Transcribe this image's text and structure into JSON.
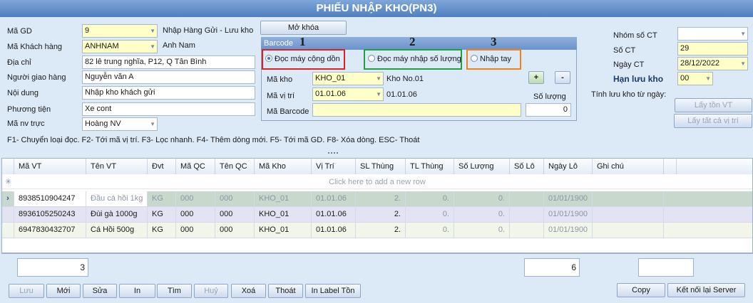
{
  "title": "PHIẾU NHẬP KHO(PN3)",
  "form": {
    "ma_gd": {
      "label": "Mã GD",
      "value": "9",
      "note": "Nhập Hàng Gửi - Lưu kho"
    },
    "ma_kh": {
      "label": "Mã Khách hàng",
      "value": "ANHNAM",
      "note": "Anh Nam"
    },
    "dia_chi": {
      "label": "Địa chỉ",
      "value": "82 lê trung nghĩa, P12, Q Tân Bình"
    },
    "nguoi_giao": {
      "label": "Người giao hàng",
      "value": "Nguyễn văn A"
    },
    "noi_dung": {
      "label": "Nội dung",
      "value": "Nhập kho khách gửi"
    },
    "phuong_tien": {
      "label": "Phương tiện",
      "value": "Xe cont"
    },
    "ma_nv": {
      "label": "Mã nv trực",
      "value": "Hoàng NV"
    }
  },
  "mo_khoa_label": "Mở khóa",
  "barcode": {
    "header": "Barcode",
    "numbers": [
      "1",
      "2",
      "3"
    ],
    "options": [
      "Đọc máy cộng dồn",
      "Đọc máy nhập số lượng",
      "Nhập tay"
    ],
    "ma_kho": {
      "label": "Mã kho",
      "value": "KHO_01",
      "note": "Kho No.01"
    },
    "ma_vi_tri": {
      "label": "Mã vị trí",
      "value": "01.01.06",
      "note": "01.01.06"
    },
    "ma_barcode": {
      "label": "Mã Barcode",
      "value": ""
    },
    "so_luong": {
      "label": "Số lượng",
      "value": "0"
    },
    "plus": "+",
    "minus": "-"
  },
  "right": {
    "nhom_so_ct": {
      "label": "Nhóm số CT",
      "value": ""
    },
    "so_ct": {
      "label": "Số CT",
      "value": "29"
    },
    "ngay_ct": {
      "label": "Ngày CT",
      "value": "28/12/2022"
    },
    "han_luu_kho": {
      "label": "Hạn lưu kho",
      "value": "00"
    },
    "tinh_luu_kho": "Tính lưu kho từ ngày:",
    "lay_ton_vt": "Lấy tồn VT",
    "lay_tat_ca": "Lấy tất cả vị trí"
  },
  "hotkeys": "F1- Chuyển loại đọc. F2- Tới mã vị trí. F3- Lọc nhanh. F4- Thêm dòng mới. F5- Tới mã GD. F8- Xóa dòng. ESC- Thoát",
  "grid": {
    "columns": [
      "Mã VT",
      "Tên VT",
      "Đvt",
      "Mã QC",
      "Tên QC",
      "Mã Kho",
      "Vị Trí",
      "SL Thùng",
      "TL Thùng",
      "Số Lượng",
      "Số Lô",
      "Ngày Lô",
      "Ghi chú"
    ],
    "new_row_hint": "Click here to add a new row",
    "row_marker": "›",
    "new_row_marker": "✳",
    "rows": [
      [
        "8938510904247",
        "Đầu cá hồi 1kg",
        "KG",
        "000",
        "000",
        "KHO_01",
        "01.01.06",
        "2.",
        "0.",
        "0.",
        "",
        "01/01/1900",
        ""
      ],
      [
        "8936105250243",
        "Đùi gà 1000g",
        "KG",
        "000",
        "000",
        "KHO_01",
        "01.01.06",
        "2.",
        "0.",
        "0.",
        "",
        "01/01/1900",
        ""
      ],
      [
        "6947830432707",
        "Cá Hồi 500g",
        "KG",
        "000",
        "000",
        "KHO_01",
        "01.01.06",
        "2.",
        "0.",
        "0.",
        "",
        "01/01/1900",
        ""
      ]
    ]
  },
  "totals": {
    "count": "3",
    "sum": "6",
    "extra": ""
  },
  "buttons": [
    "Lưu",
    "Mới",
    "Sửa",
    "In",
    "Tìm",
    "Huỷ",
    "Xoá",
    "Thoát",
    "In Label Tồn"
  ],
  "right_buttons": [
    "Copy",
    "Kết nối lại Server"
  ],
  "colors": {
    "red_box": "#e02020",
    "green_box": "#20a040",
    "orange_box": "#f08020",
    "header_blue": "#4f7fc0"
  }
}
